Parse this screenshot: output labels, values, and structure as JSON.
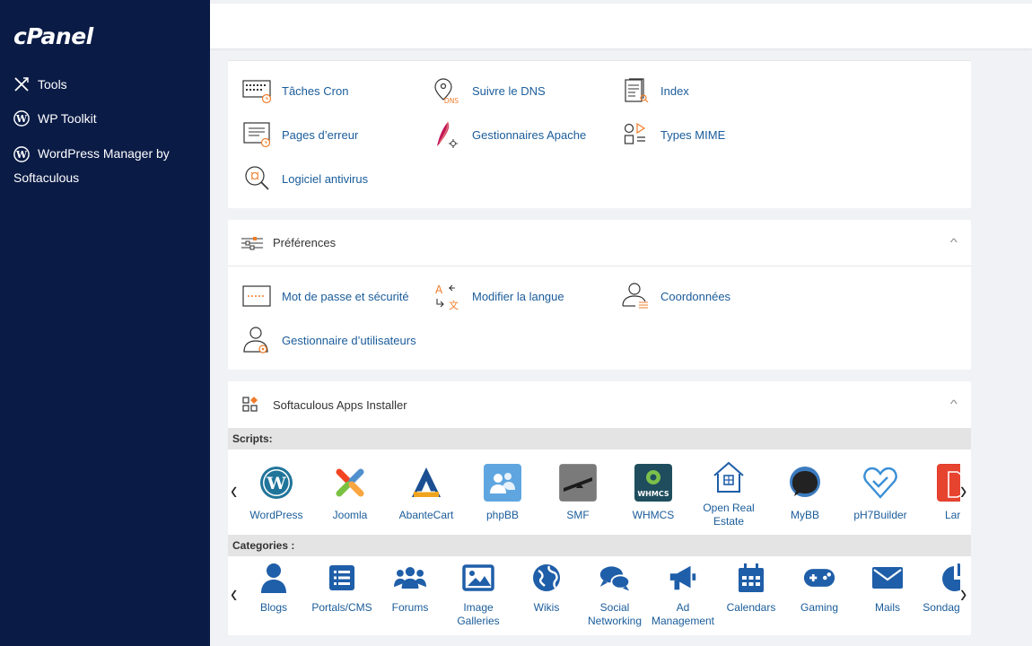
{
  "sidebar": {
    "logo": "cPanel",
    "items": [
      {
        "label": "Tools",
        "icon": "tools-icon"
      },
      {
        "label": "WP Toolkit",
        "icon": "wordpress-icon"
      },
      {
        "label": "WordPress Manager by Softaculous",
        "icon": "wordpress-icon"
      }
    ]
  },
  "advanced": {
    "tools": [
      {
        "label": "Tâches Cron",
        "icon": "cron-icon"
      },
      {
        "label": "Suivre le DNS",
        "icon": "dns-icon"
      },
      {
        "label": "Index",
        "icon": "index-icon"
      },
      {
        "label": "Pages d’erreur",
        "icon": "error-pages-icon"
      },
      {
        "label": "Gestionnaires Apache",
        "icon": "apache-feather-icon"
      },
      {
        "label": "Types MIME",
        "icon": "mime-icon"
      },
      {
        "label": "Logiciel antivirus",
        "icon": "antivirus-icon"
      }
    ]
  },
  "preferences": {
    "title": "Préférences",
    "tools": [
      {
        "label": "Mot de passe et sécurité",
        "icon": "password-icon"
      },
      {
        "label": "Modifier la langue",
        "icon": "language-icon"
      },
      {
        "label": "Coordonnées",
        "icon": "contact-icon"
      },
      {
        "label": "Gestionnaire d’utilisateurs",
        "icon": "user-manager-icon"
      }
    ]
  },
  "softaculous": {
    "title": "Softaculous Apps Installer",
    "scripts_label": "Scripts:",
    "categories_label": "Categories :",
    "prev_arrow": "‹",
    "next_arrow": "›",
    "scripts": [
      {
        "label": "WordPress"
      },
      {
        "label": "Joomla"
      },
      {
        "label": "AbanteCart"
      },
      {
        "label": "phpBB"
      },
      {
        "label": "SMF"
      },
      {
        "label": "WHMCS"
      },
      {
        "label": "Open Real Estate"
      },
      {
        "label": "MyBB"
      },
      {
        "label": "pH7Builder"
      },
      {
        "label": "Lara"
      }
    ],
    "categories": [
      {
        "label": "Blogs"
      },
      {
        "label": "Portals/CMS"
      },
      {
        "label": "Forums"
      },
      {
        "label": "Image Galleries"
      },
      {
        "label": "Wikis"
      },
      {
        "label": "Social Networking"
      },
      {
        "label": "Ad Management"
      },
      {
        "label": "Calendars"
      },
      {
        "label": "Gaming"
      },
      {
        "label": "Mails"
      },
      {
        "label": "Sondag analy"
      }
    ]
  },
  "colors": {
    "sidebar": "#0a1b46",
    "link": "#1a5c9a",
    "accent_orange": "#f07c2a",
    "category_blue": "#1f5ea8"
  }
}
